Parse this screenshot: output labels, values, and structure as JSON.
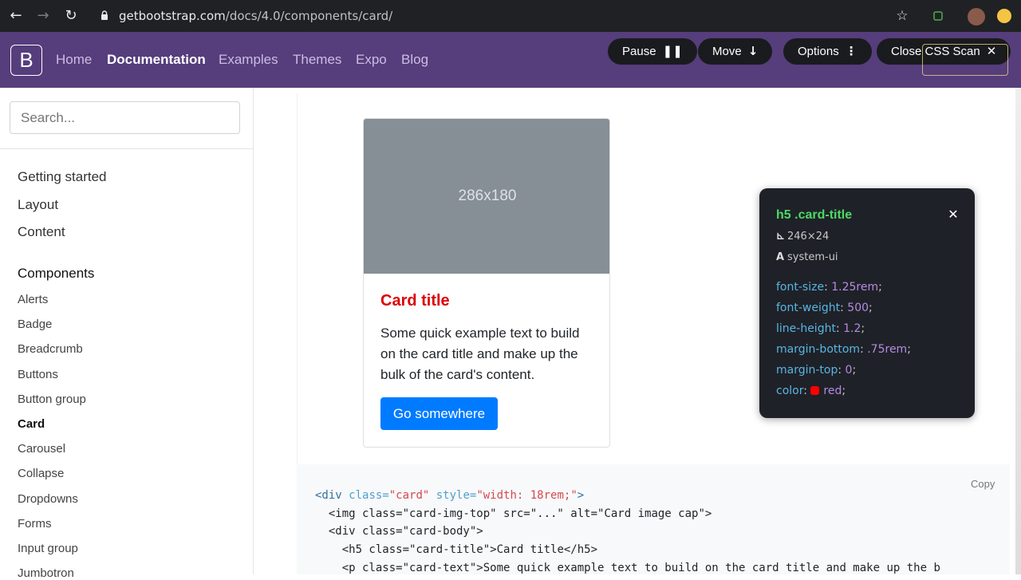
{
  "browser": {
    "url_host": "getbootstrap.com",
    "url_path": "/docs/4.0/components/card/"
  },
  "navbar": {
    "logo": "B",
    "links": [
      "Home",
      "Documentation",
      "Examples",
      "Themes",
      "Expo",
      "Blog"
    ],
    "active": "Documentation"
  },
  "css_scan_toolbar": {
    "pause": "Pause",
    "move": "Move",
    "options": "Options",
    "close": "Close CSS Scan"
  },
  "sidebar": {
    "search_placeholder": "Search...",
    "groups": [
      "Getting started",
      "Layout",
      "Content",
      "Components"
    ],
    "items": [
      "Alerts",
      "Badge",
      "Breadcrumb",
      "Buttons",
      "Button group",
      "Card",
      "Carousel",
      "Collapse",
      "Dropdowns",
      "Forms",
      "Input group",
      "Jumbotron"
    ],
    "active_item": "Card"
  },
  "card": {
    "image_label": "286x180",
    "title": "Card title",
    "text": "Some quick example text to build on the card title and make up the bulk of the card's content.",
    "button": "Go somewhere"
  },
  "css_popup": {
    "selector": "h5 .card-title",
    "size": "246×24",
    "font": "system-ui",
    "properties": [
      {
        "k": "font-size",
        "v": "1.25rem"
      },
      {
        "k": "font-weight",
        "v": "500"
      },
      {
        "k": "line-height",
        "v": "1.2"
      },
      {
        "k": "margin-bottom",
        "v": ".75rem"
      },
      {
        "k": "margin-top",
        "v": "0"
      },
      {
        "k": "color",
        "v": "red"
      }
    ],
    "color_swatch": "#ff0000"
  },
  "code": {
    "copy": "Copy",
    "line1_open": "<div",
    "line1_attr1": "class=",
    "line1_val1": "\"card\"",
    "line1_attr2": "style=",
    "line1_val2": "\"width: 18rem;\"",
    "line2": "<img class=\"card-img-top\" src=\"...\" alt=\"Card image cap\">",
    "line3": "<div class=\"card-body\">",
    "line4": "<h5 class=\"card-title\">Card title</h5>",
    "line5": "<p class=\"card-text\">Some quick example text to build on the card title and make up the b"
  }
}
